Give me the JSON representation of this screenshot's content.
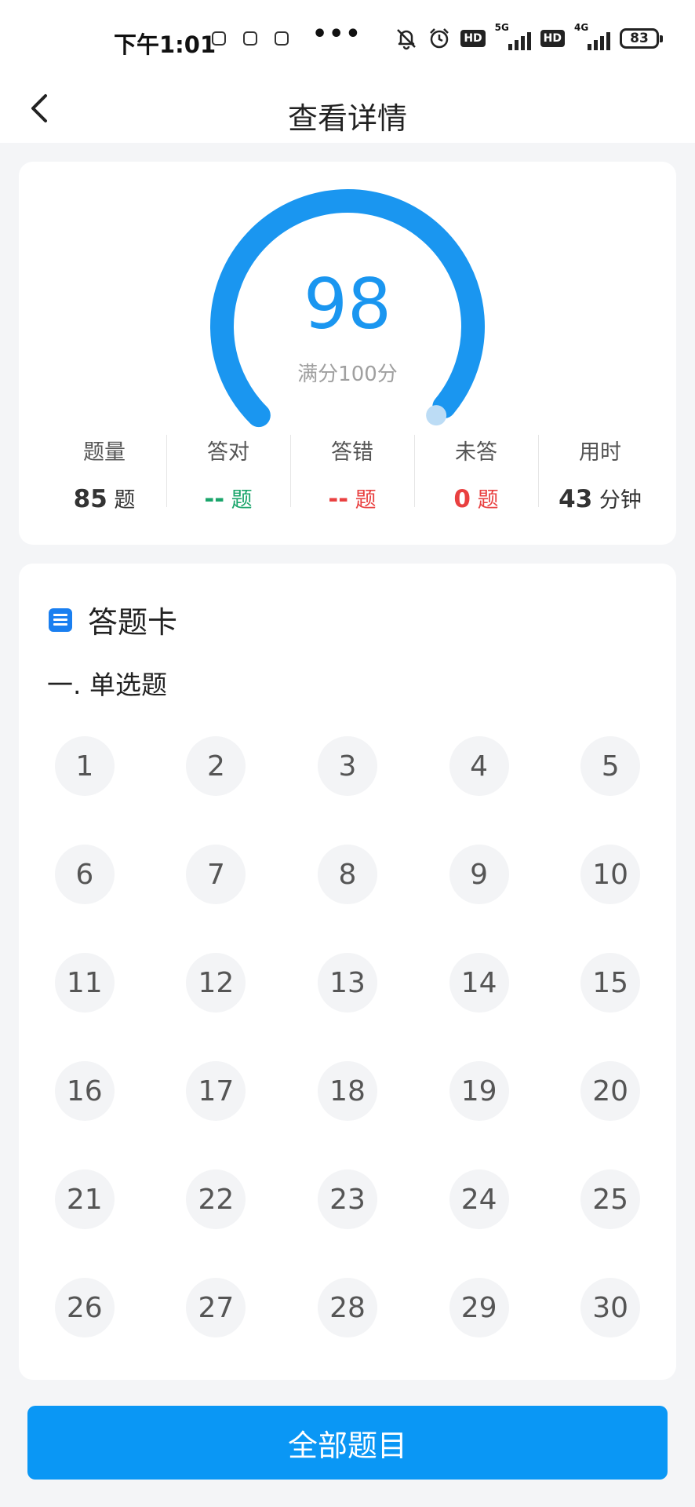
{
  "status_bar": {
    "time": "下午1:01",
    "dots": "•••",
    "hd_label": "HD",
    "network_1": "5G",
    "network_2": "4G",
    "battery": "83"
  },
  "nav": {
    "title": "查看详情"
  },
  "score": {
    "value": "98",
    "full_mark_text": "满分100分",
    "fraction": 0.98,
    "gauge_color": "#1a96f0"
  },
  "stats": [
    {
      "label": "题量",
      "value": "85",
      "unit": "题",
      "color": "#333333"
    },
    {
      "label": "答对",
      "value": "--",
      "unit": "题",
      "color": "#1aa56b"
    },
    {
      "label": "答错",
      "value": "--",
      "unit": "题",
      "color": "#e94040"
    },
    {
      "label": "未答",
      "value": "0",
      "unit": "题",
      "color": "#e94040"
    },
    {
      "label": "用时",
      "value": "43",
      "unit": "分钟",
      "color": "#333333"
    }
  ],
  "answer_sheet": {
    "title": "答题卡",
    "section_title": "一. 单选题",
    "questions": [
      "1",
      "2",
      "3",
      "4",
      "5",
      "6",
      "7",
      "8",
      "9",
      "10",
      "11",
      "12",
      "13",
      "14",
      "15",
      "16",
      "17",
      "18",
      "19",
      "20",
      "21",
      "22",
      "23",
      "24",
      "25",
      "26",
      "27",
      "28",
      "29",
      "30"
    ]
  },
  "footer": {
    "all_questions_label": "全部题目",
    "button_color": "#0a97f5"
  }
}
